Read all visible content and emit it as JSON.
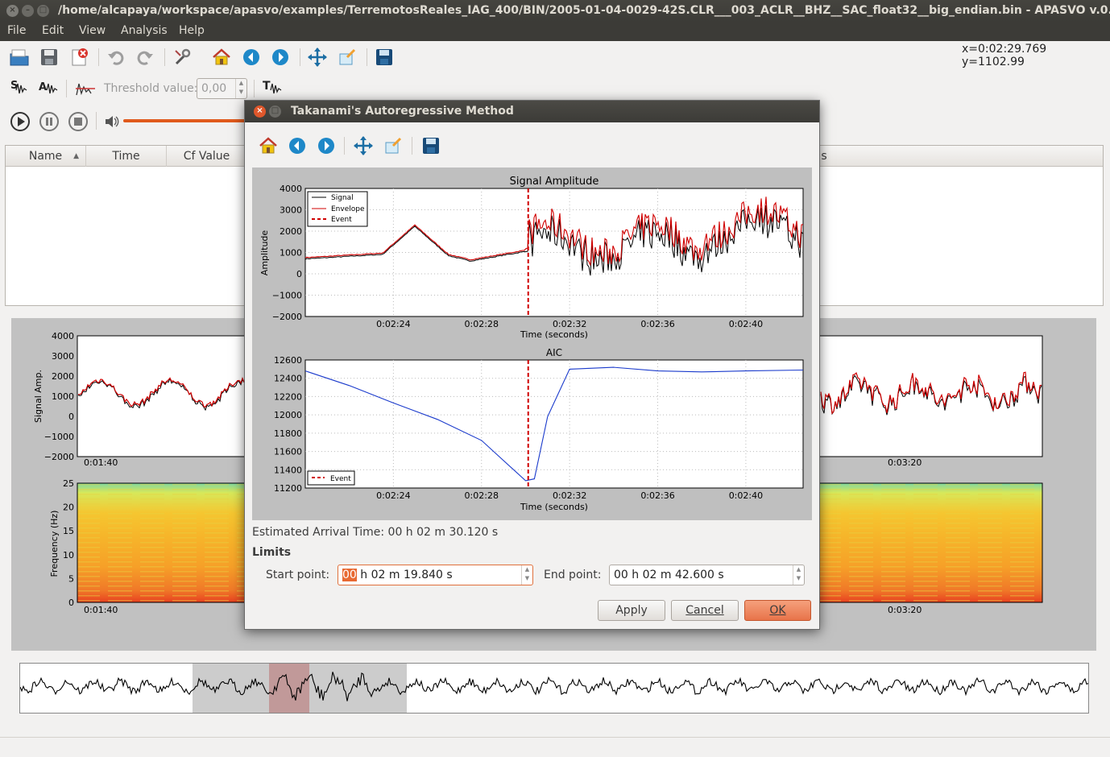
{
  "window": {
    "title": "/home/alcapaya/workspace/apasvo/examples/TerremotosReales_IAG_400/BIN/2005-01-04-0029-42S.CLR___003_ACLR__BHZ__SAC_float32__big_endian.bin - APASVO v.0.0.2"
  },
  "menu": [
    "File",
    "Edit",
    "View",
    "Analysis",
    "Help"
  ],
  "toolbar": {
    "coords": "x=0:02:29.769 y=1102.99",
    "threshold_label": "Threshold value:",
    "threshold_value": "0,00",
    "icons": [
      "open-icon",
      "save-icon",
      "close-file-icon",
      "undo-icon",
      "redo-icon",
      "settings-icon",
      "home-icon",
      "back-icon",
      "forward-icon",
      "pan-icon",
      "zoom-icon",
      "save-figure-icon",
      "sta-lta-icon",
      "amp-icon",
      "threshold-icon",
      "takanami-icon",
      "play-icon",
      "pause-icon",
      "stop-icon",
      "volume-icon"
    ]
  },
  "table": {
    "headers": [
      "Name",
      "Time",
      "Cf Value"
    ],
    "hidden_header_tail": "s"
  },
  "main_plots": {
    "signal": {
      "ylabel": "Signal Amp.",
      "yticks": [
        "4000",
        "3000",
        "2000",
        "1000",
        "0",
        "−1000",
        "−2000"
      ],
      "xticks": [
        "0:01:40",
        "0:03:20"
      ]
    },
    "spectrogram": {
      "ylabel": "Frequency (Hz)",
      "yticks": [
        "25",
        "20",
        "15",
        "10",
        "5",
        "0"
      ],
      "xticks": [
        "0:01:40",
        "0:03:20"
      ]
    }
  },
  "dialog": {
    "title": "Takanami's Autoregressive Method",
    "estimated_arrival": "Estimated Arrival Time: 00 h 02 m 30.120 s",
    "limits_label": "Limits",
    "start_label": "Start point:",
    "start_hours": "00",
    "start_rest": " h 02 m 19.840 s",
    "end_label": "End point:",
    "end_value": "00 h 02 m 42.600 s",
    "buttons": {
      "apply": "Apply",
      "cancel": "Cancel",
      "ok": "OK"
    }
  },
  "chart_data": [
    {
      "type": "line",
      "title": "Signal Amplitude",
      "xlabel": "Time (seconds)",
      "ylabel": "Amplitude",
      "x_ticks": [
        "0:02:24",
        "0:02:28",
        "0:02:32",
        "0:02:36",
        "0:02:40"
      ],
      "ylim": [
        -2000,
        4000
      ],
      "y_ticks": [
        "4000",
        "3000",
        "2000",
        "1000",
        "0",
        "−1000",
        "−2000"
      ],
      "legend": [
        "Signal",
        "Envelope",
        "Event"
      ],
      "legend_position": "top-left",
      "grid": true,
      "colors": {
        "Signal": "#000000",
        "Envelope": "#d00000",
        "Event": "#d00000"
      },
      "event_time": "0:02:30.120"
    },
    {
      "type": "line",
      "title": "AIC",
      "xlabel": "Time (seconds)",
      "ylabel": "",
      "x_ticks": [
        "0:02:24",
        "0:02:28",
        "0:02:32",
        "0:02:36",
        "0:02:40"
      ],
      "ylim": [
        11200,
        12600
      ],
      "y_ticks": [
        "12600",
        "12400",
        "12200",
        "12000",
        "11800",
        "11600",
        "11400",
        "11200"
      ],
      "legend": [
        "Event"
      ],
      "legend_position": "bottom-left",
      "grid": true,
      "series": [
        {
          "name": "AIC",
          "color": "#1a3acc",
          "x": [
            "0:02:20",
            "0:02:22",
            "0:02:24",
            "0:02:26",
            "0:02:28",
            "0:02:30",
            "0:02:30.4",
            "0:02:31",
            "0:02:32",
            "0:02:34",
            "0:02:36",
            "0:02:38",
            "0:02:40",
            "0:02:42.6"
          ],
          "values": [
            12480,
            12320,
            12130,
            11950,
            11720,
            11280,
            11300,
            11980,
            12500,
            12520,
            12480,
            12470,
            12480,
            12490
          ]
        }
      ]
    }
  ]
}
